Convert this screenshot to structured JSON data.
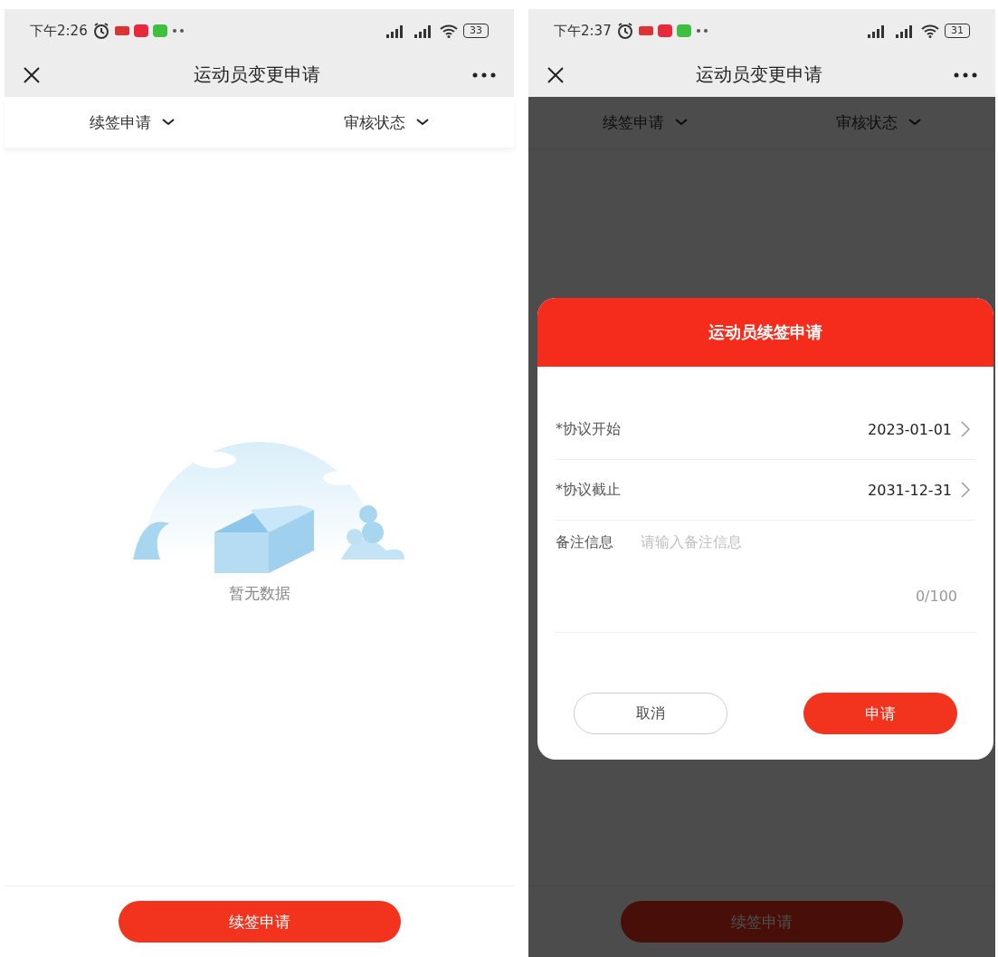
{
  "screens": [
    {
      "status_bar": {
        "time": "下午2:26",
        "battery": "33"
      },
      "nav": {
        "title": "运动员变更申请"
      },
      "filters": [
        {
          "label": "续签申请"
        },
        {
          "label": "审核状态"
        }
      ],
      "empty_state": {
        "text": "暂无数据"
      },
      "bottom_button": "续签申请",
      "dimmed": false
    },
    {
      "status_bar": {
        "time": "下午2:37",
        "battery": "31"
      },
      "nav": {
        "title": "运动员变更申请"
      },
      "filters": [
        {
          "label": "续签申请"
        },
        {
          "label": "审核状态"
        }
      ],
      "bottom_button": "续签申请",
      "dimmed": true,
      "dialog": {
        "title": "运动员续签申请",
        "fields": [
          {
            "kind": "date",
            "label": "*协议开始",
            "value": "2023-01-01"
          },
          {
            "kind": "date",
            "label": "*协议截止",
            "value": "2031-12-31"
          },
          {
            "kind": "textarea",
            "label": "备注信息",
            "placeholder": "请输入备注信息",
            "counter": "0/100"
          }
        ],
        "buttons": [
          {
            "kind": "cancel",
            "label": "取消"
          },
          {
            "kind": "submit",
            "label": "申请"
          }
        ]
      }
    }
  ]
}
